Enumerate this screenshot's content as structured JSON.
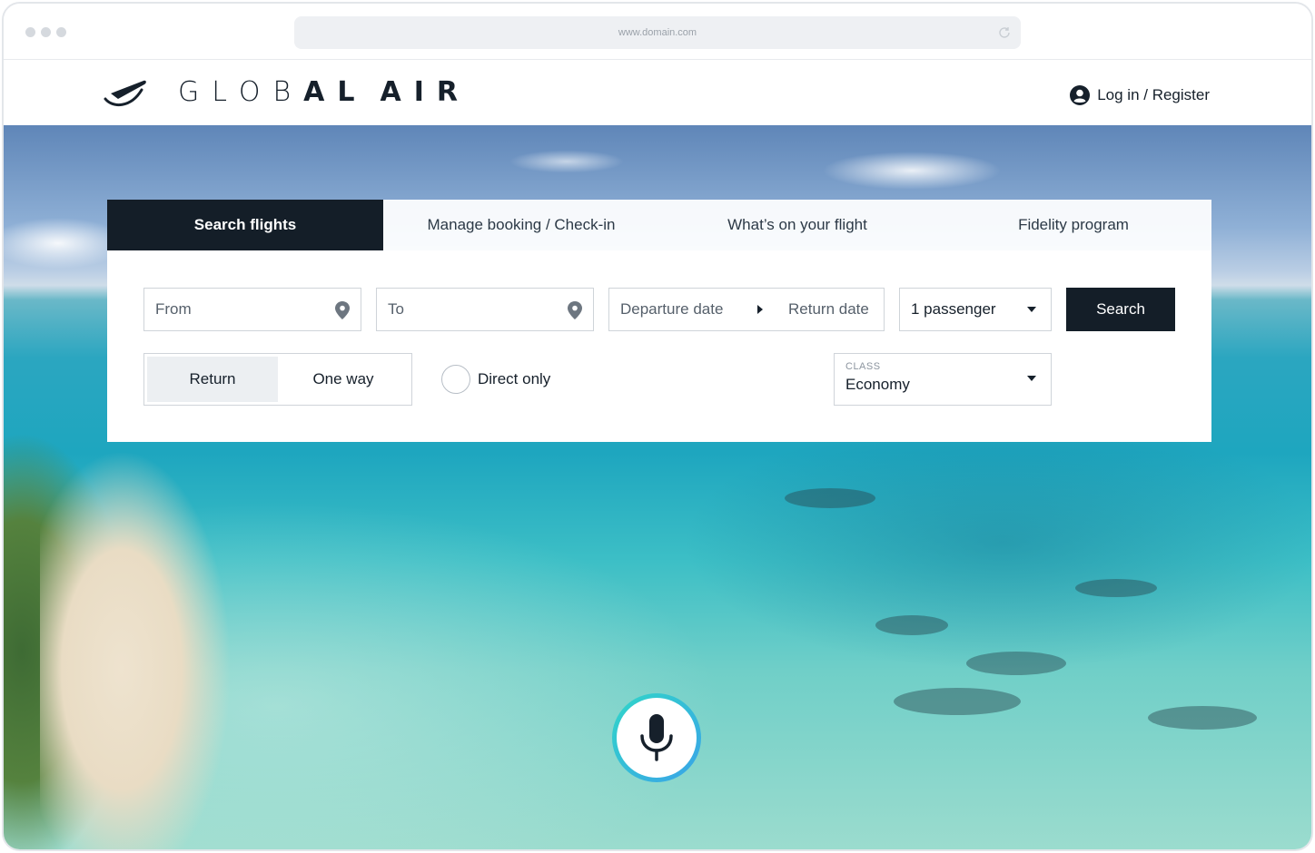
{
  "browser": {
    "url": "www.domain.com"
  },
  "header": {
    "brand_first": "GLOB",
    "brand_second": "AL",
    "brand_third": "AIR",
    "login_label": "Log in / Register"
  },
  "tabs": [
    {
      "label": "Search flights",
      "active": true
    },
    {
      "label": "Manage booking / Check-in"
    },
    {
      "label": "What’s on your flight"
    },
    {
      "label": "Fidelity program"
    }
  ],
  "form": {
    "from_placeholder": "From",
    "to_placeholder": "To",
    "departure_placeholder": "Departure date",
    "return_placeholder": "Return date",
    "passengers": "1 passenger",
    "search_label": "Search",
    "trip_types": [
      "Return",
      "One way"
    ],
    "trip_selected": "Return",
    "direct_label": "Direct only",
    "class_label": "CLASS",
    "class_value": "Economy"
  },
  "colors": {
    "primary_dark": "#141e28",
    "mic_gradient_start": "#30d6c8",
    "mic_gradient_end": "#3aa3e8"
  },
  "icons": {
    "logo": "plane-swoosh-icon",
    "user": "user-circle-icon",
    "location": "location-pin-icon",
    "microphone": "microphone-icon"
  }
}
